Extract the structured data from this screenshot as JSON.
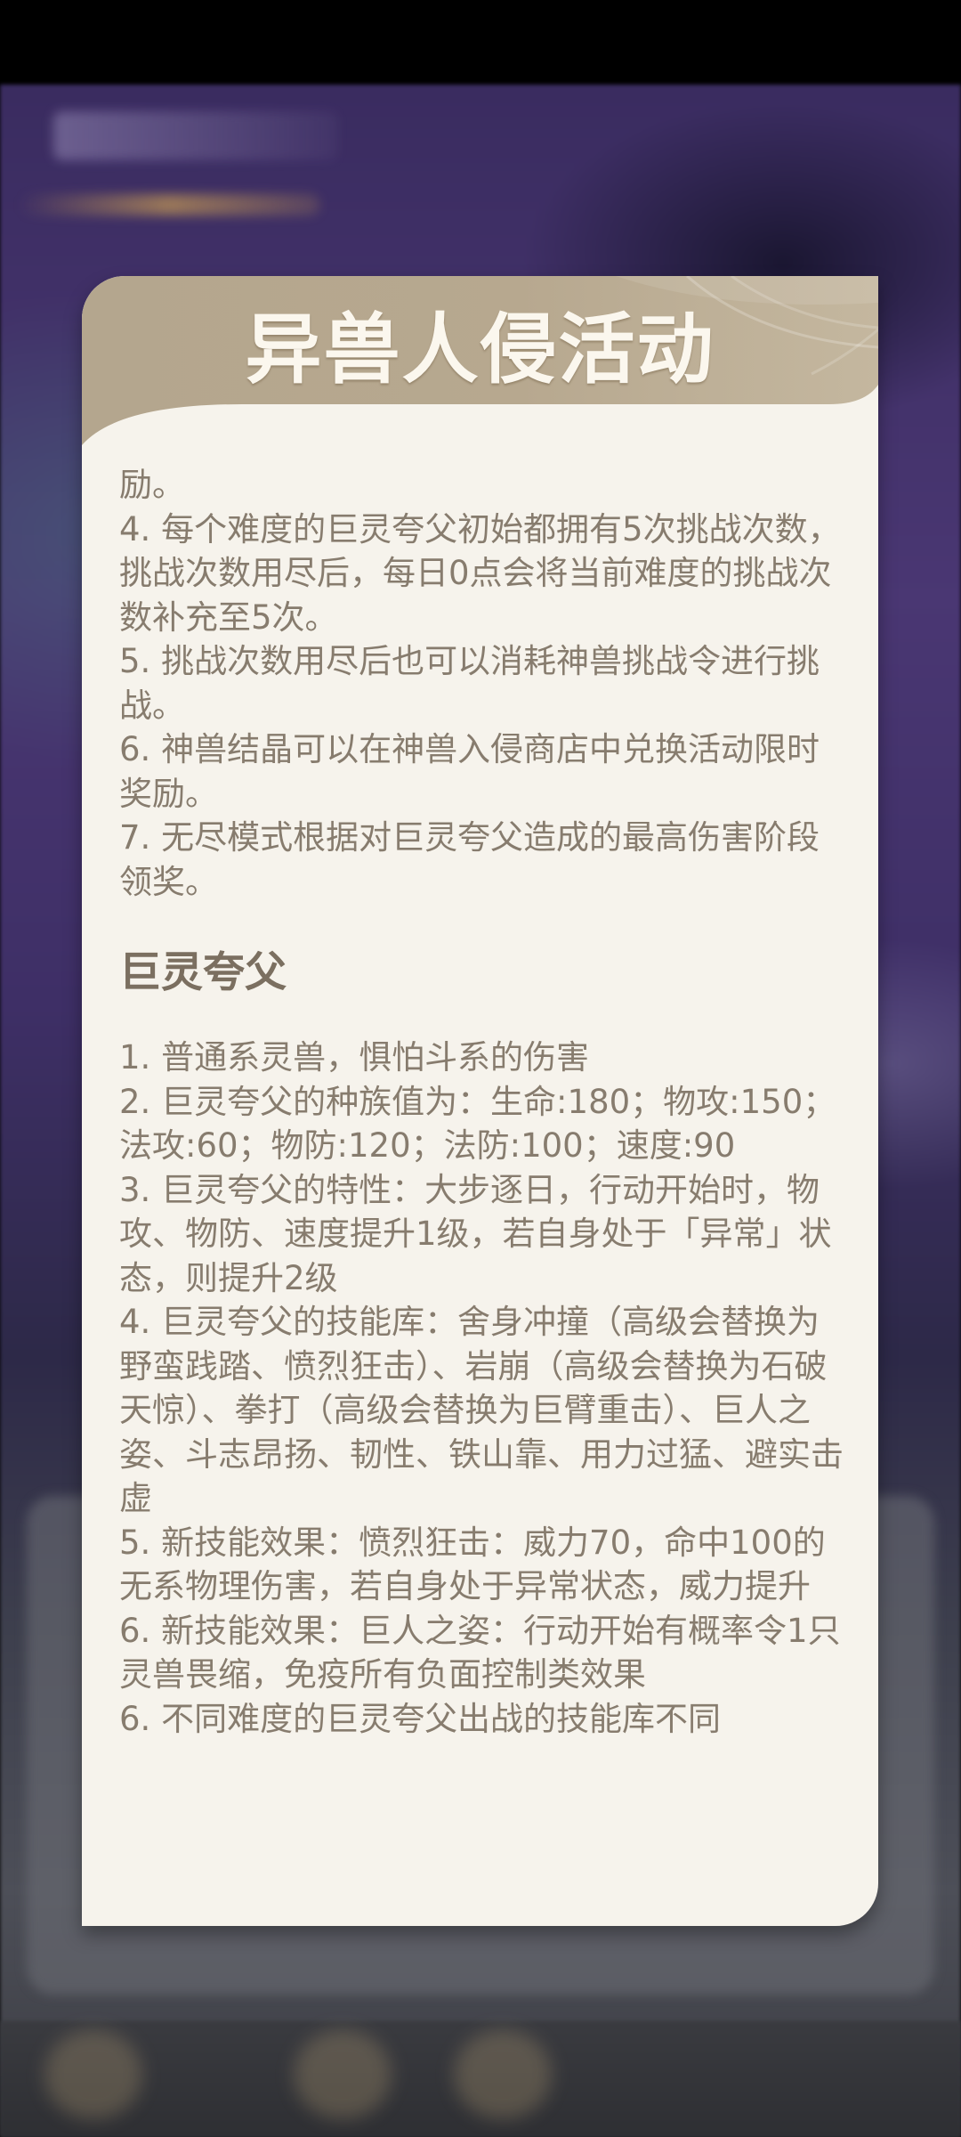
{
  "dialog": {
    "title": "异兽人侵活动",
    "intro_lines": [
      "励。",
      "4. 每个难度的巨灵夸父初始都拥有5次挑战次数，挑战次数用尽后，每日0点会将当前难度的挑战次数补充至5次。",
      "5. 挑战次数用尽后也可以消耗神兽挑战令进行挑战。",
      "6. 神兽结晶可以在神兽入侵商店中兑换活动限时奖励。",
      "7. 无尽模式根据对巨灵夸父造成的最高伤害阶段领奖。"
    ],
    "section_title": "巨灵夸父",
    "section_lines": [
      "1. 普通系灵兽，惧怕斗系的伤害",
      "2. 巨灵夸父的种族值为：生命:180；物攻:150；法攻:60；物防:120；法防:100；速度:90",
      "3. 巨灵夸父的特性：大步逐日，行动开始时，物攻、物防、速度提升1级，若自身处于「异常」状态，则提升2级",
      "4. 巨灵夸父的技能库：舍身冲撞（高级会替换为野蛮践踏、愤烈狂击）、岩崩（高级会替换为石破天惊）、拳打（高级会替换为巨臂重击）、巨人之姿、斗志昂扬、韧性、铁山靠、用力过猛、避实击虚",
      "5. 新技能效果：愤烈狂击：威力70，命中100的无系物理伤害，若自身处于异常状态，威力提升",
      "6. 新技能效果：巨人之姿：行动开始有概率令1只灵兽畏缩，免疫所有负面控制类效果",
      "6. 不同难度的巨灵夸父出战的技能库不同"
    ]
  },
  "colors": {
    "header": "#b5a68d",
    "card": "#f6f3ec",
    "text": "#877c6e"
  }
}
